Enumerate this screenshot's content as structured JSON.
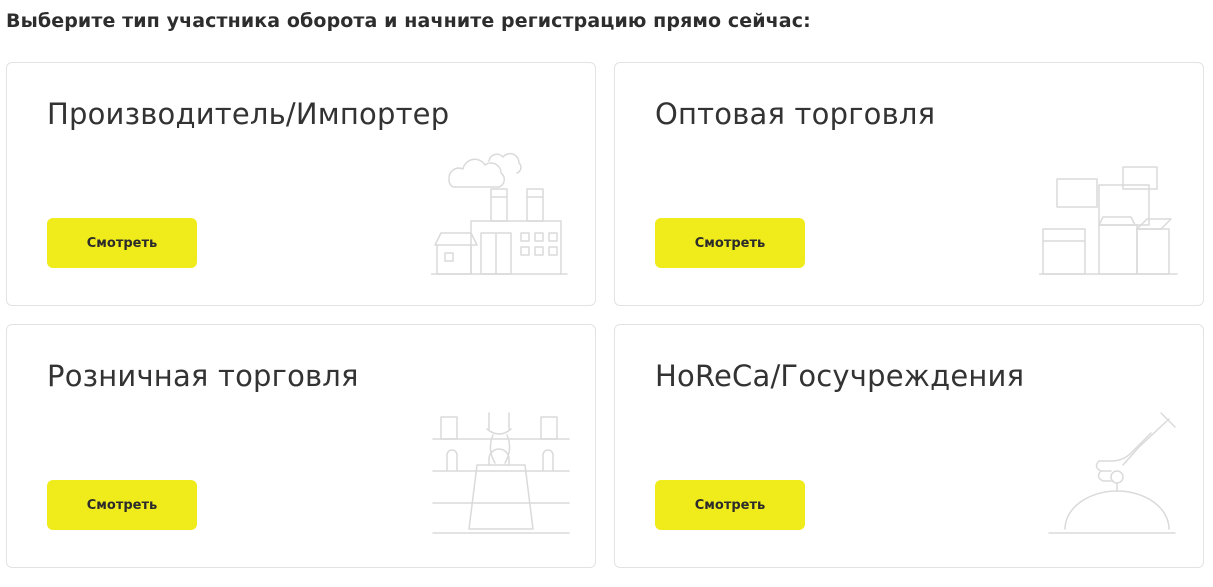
{
  "heading": "Выберите тип участника оборота и начните регистрацию прямо сейчас:",
  "colors": {
    "accent": "#f0ec1c",
    "card_border": "#e3e3e3",
    "illustration": "#dadada"
  },
  "cards": [
    {
      "title": "Производитель/Импортер",
      "button_label": "Смотреть",
      "icon": "factory-icon"
    },
    {
      "title": "Оптовая торговля",
      "button_label": "Смотреть",
      "icon": "boxes-icon"
    },
    {
      "title": "Розничная торговля",
      "button_label": "Смотреть",
      "icon": "shopping-bag-icon"
    },
    {
      "title": "HoReCa/Госучреждения",
      "button_label": "Смотреть",
      "icon": "cloche-icon"
    }
  ]
}
